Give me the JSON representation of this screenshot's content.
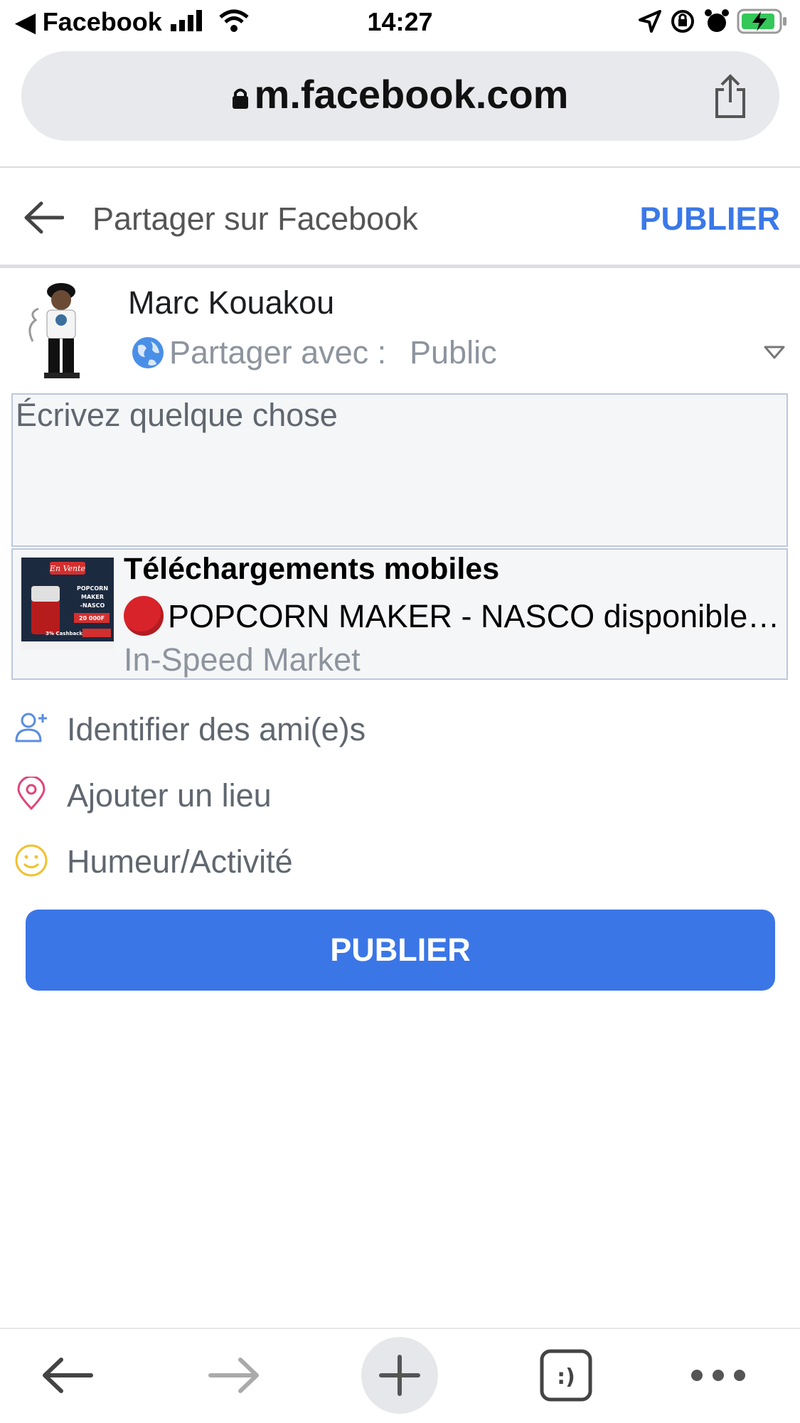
{
  "status_bar": {
    "back_app": "◀ Facebook",
    "time": "14:27"
  },
  "browser": {
    "url": "m.facebook.com"
  },
  "header": {
    "title": "Partager sur Facebook",
    "publish_label": "PUBLIER"
  },
  "profile": {
    "name": "Marc Kouakou",
    "share_label": "Partager avec :",
    "share_value": "Public"
  },
  "composer": {
    "placeholder": "Écrivez quelque chose"
  },
  "link_card": {
    "title": "Téléchargements mobiles",
    "description": "POPCORN MAKER - NASCO disponible",
    "source": "In-Speed Market",
    "thumbnail": {
      "badge": "En Vente",
      "product": "POPCORN MAKER -NASCO",
      "price": "20 000F",
      "cashback": "3% Cashback"
    }
  },
  "actions": [
    {
      "label": "Identifier des ami(e)s",
      "icon": "tag-friends-icon"
    },
    {
      "label": "Ajouter un lieu",
      "icon": "location-pin-icon"
    },
    {
      "label": "Humeur/Activité",
      "icon": "smiley-icon"
    }
  ],
  "publish_button": {
    "label": "PUBLIER"
  },
  "colors": {
    "accent": "#3b78e7",
    "button": "#3b76e6",
    "muted_text": "#8d949e"
  }
}
